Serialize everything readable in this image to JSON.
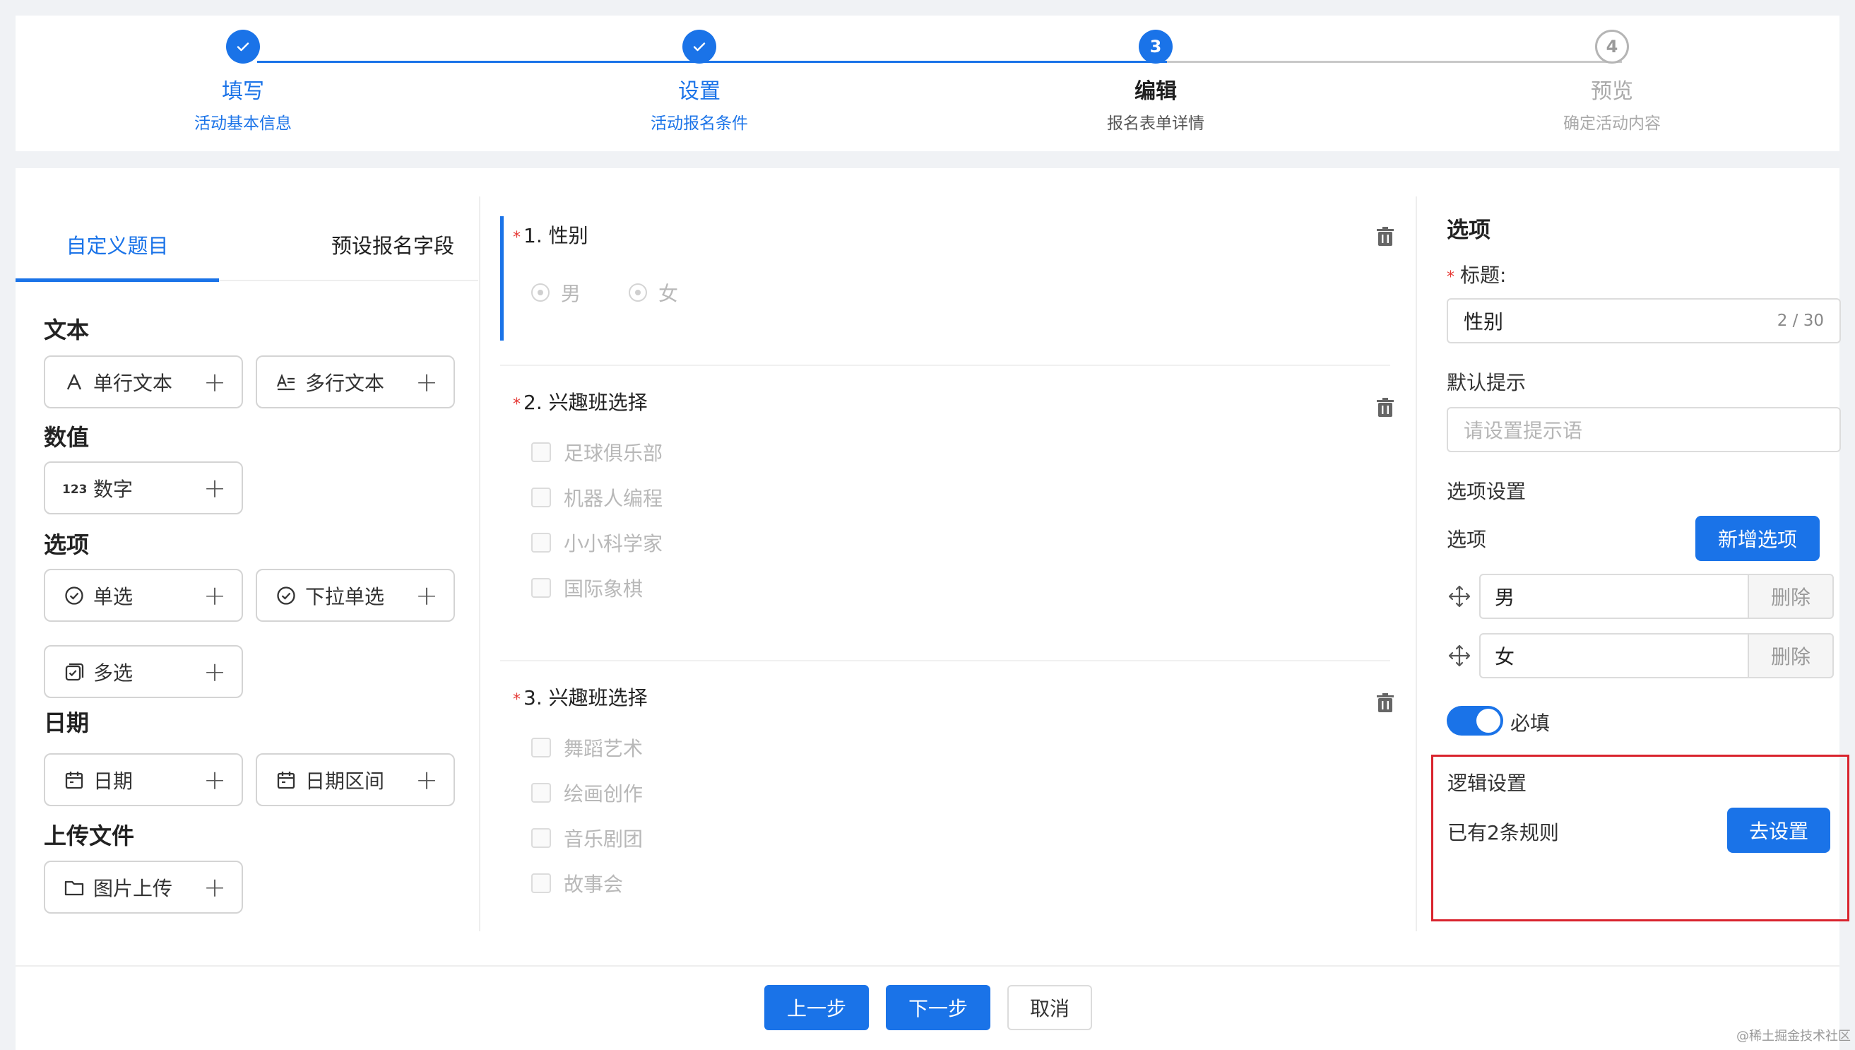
{
  "steps": [
    {
      "title": "填写",
      "desc": "活动基本信息",
      "state": "done",
      "number": ""
    },
    {
      "title": "设置",
      "desc": "活动报名条件",
      "state": "done",
      "number": ""
    },
    {
      "title": "编辑",
      "desc": "报名表单详情",
      "state": "active",
      "number": "3"
    },
    {
      "title": "预览",
      "desc": "确定活动内容",
      "state": "wait",
      "number": "4"
    }
  ],
  "left": {
    "tabs": [
      "自定义题目",
      "预设报名字段"
    ],
    "groups": {
      "text": "文本",
      "number": "数值",
      "choice": "选项",
      "date": "日期",
      "upload": "上传文件"
    },
    "fields": {
      "single_text": "单行文本",
      "multi_text": "多行文本",
      "number": "数字",
      "radio": "单选",
      "dropdown": "下拉单选",
      "checkbox": "多选",
      "date": "日期",
      "date_range": "日期区间",
      "image_upload": "图片上传"
    },
    "plus": "+"
  },
  "questions": [
    {
      "title": "1. 性别",
      "required": "*",
      "type": "radio",
      "options": [
        "男",
        "女"
      ]
    },
    {
      "title": "2. 兴趣班选择",
      "required": "*",
      "type": "checkbox",
      "options": [
        "足球俱乐部",
        "机器人编程",
        "小小科学家",
        "国际象棋"
      ]
    },
    {
      "title": "3. 兴趣班选择",
      "required": "*",
      "type": "checkbox",
      "options": [
        "舞蹈艺术",
        "绘画创作",
        "音乐剧团",
        "故事会"
      ]
    }
  ],
  "right": {
    "section_title": "选项",
    "title_label": "标题:",
    "title_required": "*",
    "title_value": "性别",
    "title_counter": "2 / 30",
    "hint_label": "默认提示",
    "hint_placeholder": "请设置提示语",
    "options_setting_label": "选项设置",
    "options_label": "选项",
    "add_option": "新增选项",
    "options": [
      "男",
      "女"
    ],
    "delete_label": "删除",
    "required_label": "必填",
    "required_on": true,
    "logic_title": "逻辑设置",
    "logic_status": "已有2条规则",
    "logic_button": "去设置"
  },
  "footer": {
    "prev": "上一步",
    "next": "下一步",
    "cancel": "取消"
  },
  "watermark": "@稀土掘金技术社区",
  "colors": {
    "primary": "#1a73e8",
    "highlight_border": "#d9232d",
    "required": "#e53935"
  }
}
